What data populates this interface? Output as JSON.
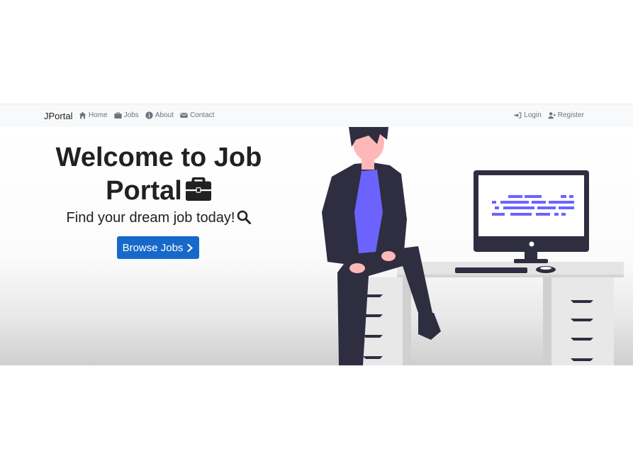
{
  "navbar": {
    "brand": "JPortal",
    "left_links": [
      {
        "label": "Home",
        "icon": "home-icon"
      },
      {
        "label": "Jobs",
        "icon": "briefcase-icon"
      },
      {
        "label": "About",
        "icon": "info-circle-icon"
      },
      {
        "label": "Contact",
        "icon": "envelope-icon"
      }
    ],
    "right_links": [
      {
        "label": "Login",
        "icon": "sign-in-icon"
      },
      {
        "label": "Register",
        "icon": "user-plus-icon"
      }
    ]
  },
  "hero": {
    "title_line1": "Welcome to Job",
    "title_line2": "Portal",
    "title_icon": "briefcase-icon",
    "subtitle": "Find your dream job today!",
    "subtitle_icon": "search-icon",
    "button_label": "Browse Jobs",
    "button_icon": "chevron-right-icon"
  },
  "illustration": {
    "description_icon": "person-at-desk-illustration"
  },
  "colors": {
    "navbar_bg": "#f8f9fa",
    "nav_text": "#6c757d",
    "button_bg": "#1769c9",
    "accent_purple": "#6c63ff",
    "figure_dark": "#2f2e41"
  }
}
